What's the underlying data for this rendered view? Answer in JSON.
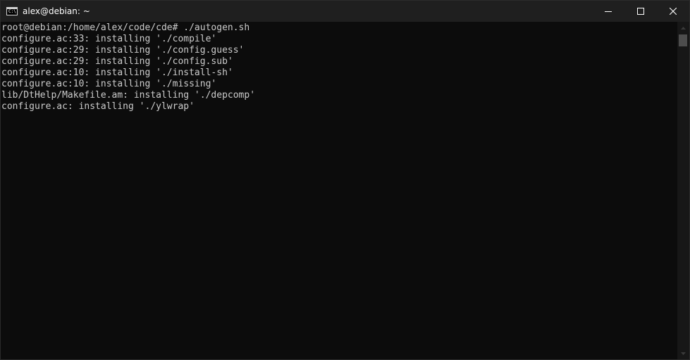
{
  "window": {
    "title": "alex@debian: ~",
    "icon": "console-icon",
    "icon_text": "C:\\",
    "controls": [
      "minimize-icon",
      "maximize-icon",
      "close-icon"
    ]
  },
  "terminal": {
    "lines": [
      "root@debian:/home/alex/code/cde# ./autogen.sh",
      "configure.ac:33: installing './compile'",
      "configure.ac:29: installing './config.guess'",
      "configure.ac:29: installing './config.sub'",
      "configure.ac:10: installing './install-sh'",
      "configure.ac:10: installing './missing'",
      "lib/DtHelp/Makefile.am: installing './depcomp'",
      "configure.ac: installing './ylwrap'"
    ]
  },
  "colors": {
    "background": "#0c0c0c",
    "foreground": "#cccccc",
    "titlebar": "#1f1f1f"
  }
}
